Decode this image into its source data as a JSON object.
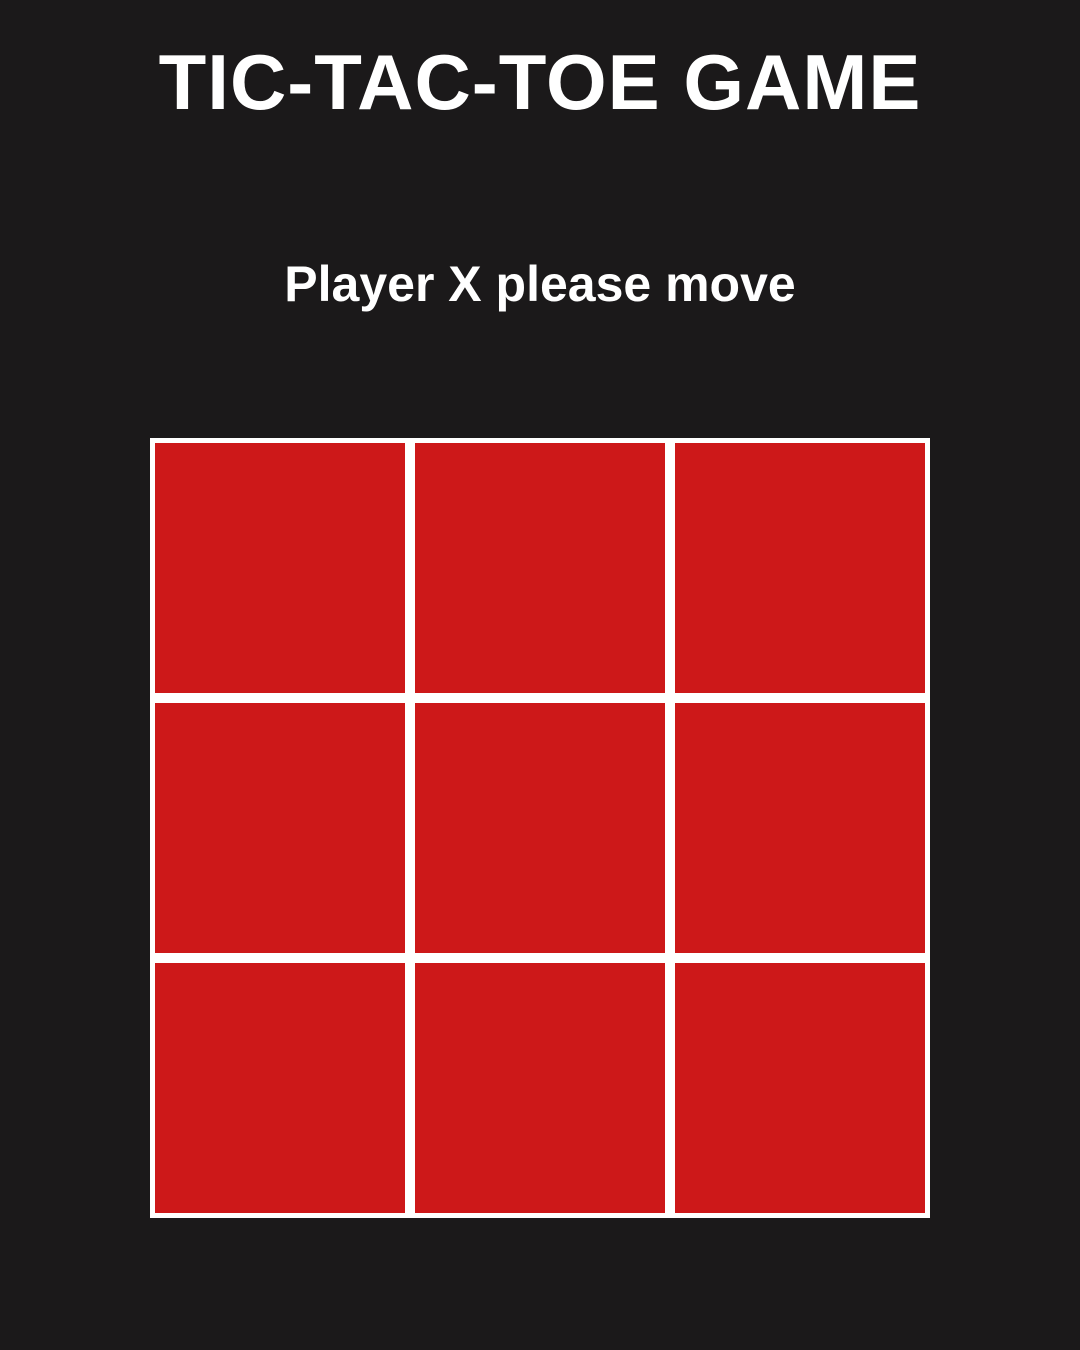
{
  "header": {
    "title": "TIC-TAC-TOE GAME"
  },
  "status": {
    "message": "Player X please move"
  },
  "board": {
    "cells": [
      "",
      "",
      "",
      "",
      "",
      "",
      "",
      "",
      ""
    ]
  },
  "colors": {
    "background": "#1b191a",
    "cell": "#cd1819",
    "grid_lines": "#ffffff",
    "text": "#ffffff"
  }
}
